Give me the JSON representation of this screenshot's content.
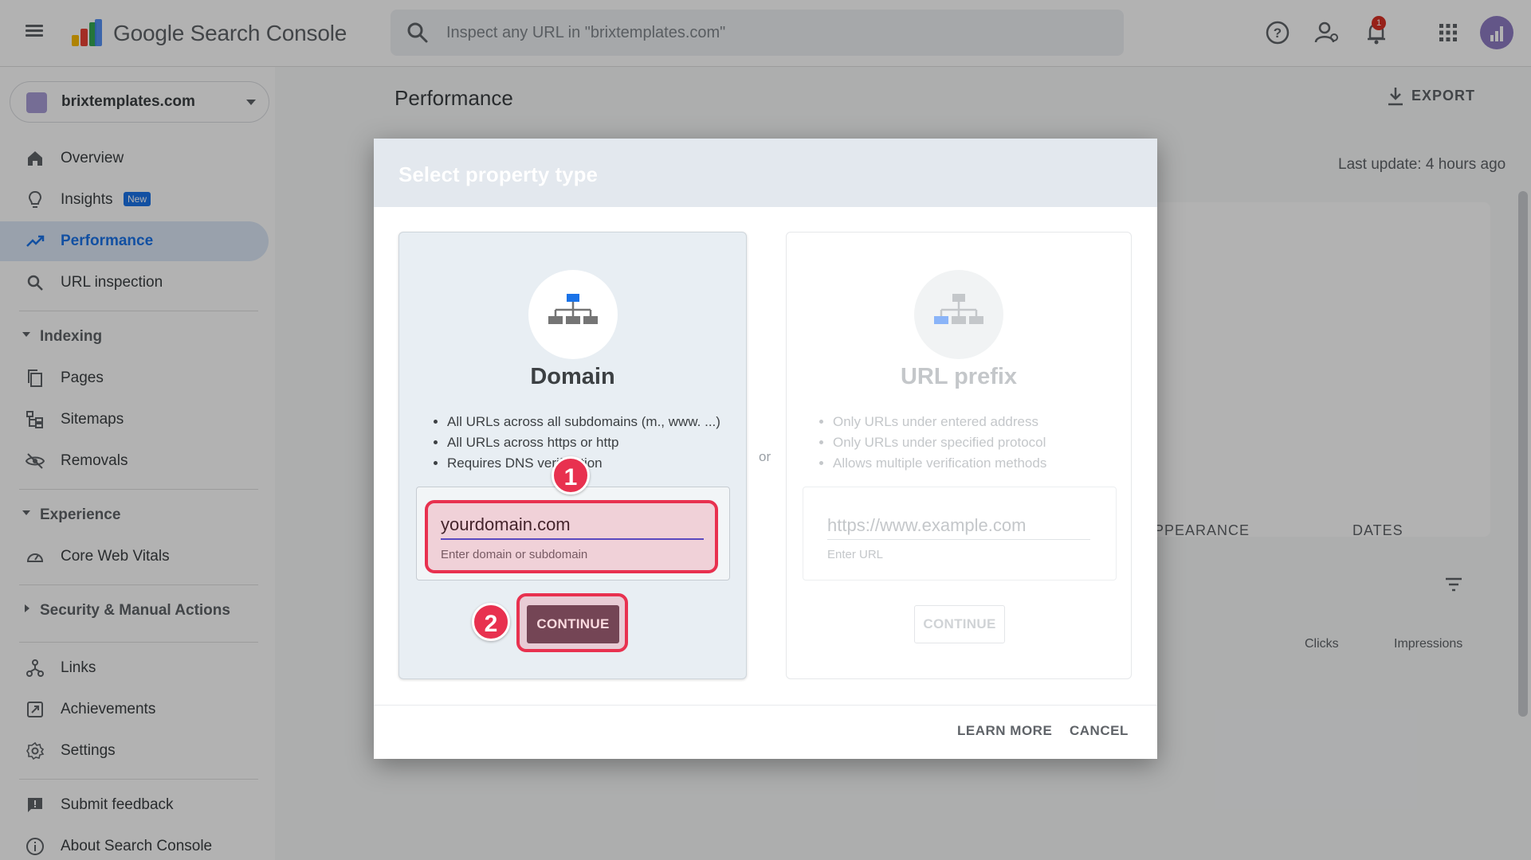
{
  "topbar": {
    "app_title": "Google Search Console",
    "search_placeholder": "Inspect any URL in \"brixtemplates.com\"",
    "notification_count": "1",
    "icons": [
      "menu-icon",
      "help-icon",
      "manage-users-icon",
      "bell-icon",
      "apps-grid-icon",
      "avatar"
    ]
  },
  "sidebar": {
    "property_name": "brixtemplates.com",
    "items": {
      "overview": "Overview",
      "insights": "Insights",
      "insights_badge": "New",
      "performance": "Performance",
      "url_inspection": "URL inspection",
      "indexing_section": "Indexing",
      "pages": "Pages",
      "sitemaps": "Sitemaps",
      "removals": "Removals",
      "experience_section": "Experience",
      "core_web_vitals": "Core Web Vitals",
      "security_section": "Security & Manual Actions",
      "links": "Links",
      "achievements": "Achievements",
      "settings": "Settings",
      "submit_feedback": "Submit feedback",
      "about": "About Search Console"
    },
    "active_item": "performance"
  },
  "main": {
    "page_title": "Performance",
    "export_label": "EXPORT",
    "last_update": "Last update: 4 hours ago",
    "tabs": [
      "APPEARANCE",
      "DATES"
    ],
    "columns": [
      "Clicks",
      "Impressions"
    ]
  },
  "dialog": {
    "title": "Select property type",
    "or_label": "or",
    "domain": {
      "heading": "Domain",
      "bullets": [
        "All URLs across all subdomains (m., www. ...)",
        "All URLs across https or http",
        "Requires DNS verification"
      ],
      "input_value": "yourdomain.com",
      "input_hint": "Enter domain or subdomain",
      "continue_label": "CONTINUE"
    },
    "url_prefix": {
      "heading": "URL prefix",
      "bullets": [
        "Only URLs under entered address",
        "Only URLs under specified protocol",
        "Allows multiple verification methods"
      ],
      "input_placeholder": "https://www.example.com",
      "input_hint": "Enter URL",
      "continue_label": "CONTINUE"
    },
    "learn_more_label": "LEARN MORE",
    "cancel_label": "CANCEL"
  },
  "annotations": {
    "step1": "1",
    "step2": "2",
    "highlight_color": "#e8314f"
  },
  "colors": {
    "accent": "#1a73e8",
    "continue_button": "#5b4a57",
    "input_underline": "#3b4fd8"
  }
}
